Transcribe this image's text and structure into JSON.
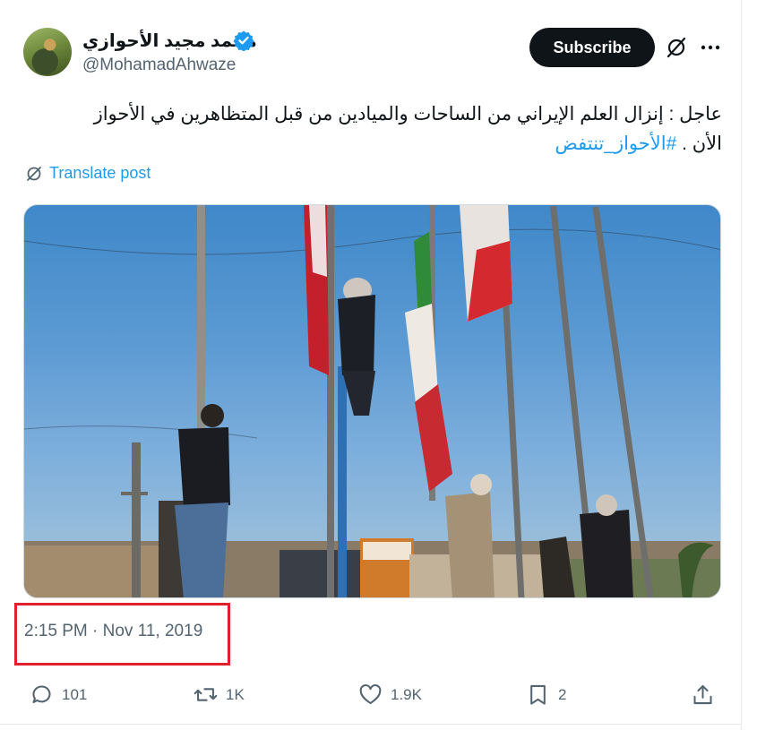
{
  "author": {
    "display_name": "محمد مجيد الأحوازي",
    "handle": "@MohamadAhwaze",
    "verified_color": "#1d9bf0"
  },
  "header": {
    "subscribe_label": "Subscribe",
    "icons": [
      "grok-icon",
      "more-icon"
    ]
  },
  "tweet": {
    "text_line1": "عاجل : إنزال العلم الإيراني من الساحات والميادين من قبل المتظاهرين في الأحواز",
    "text_line2": "الأن .",
    "hashtag": "#الأحواز_تنتفض",
    "translate_label": "Translate post"
  },
  "media": {
    "type": "video-thumbnail",
    "icon": "video-frame"
  },
  "meta": {
    "timestamp": "2:15 PM · Nov 11, 2019",
    "highlight_color": "#e0202a"
  },
  "actions": {
    "replies": "101",
    "reposts": "1K",
    "likes": "1.9K",
    "bookmarks": "2"
  },
  "colors": {
    "accent": "#1d9bf0",
    "text_secondary": "#536471",
    "button_dark": "#0f1419"
  }
}
